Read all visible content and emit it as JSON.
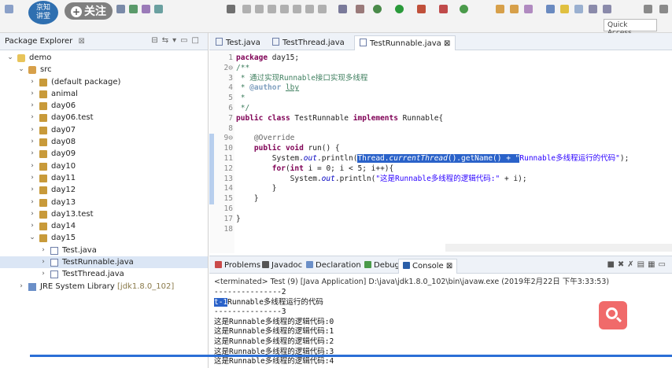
{
  "toolbar": {
    "watermark_line1": "京知",
    "watermark_line2": "讲堂",
    "follow_label": "关注",
    "quick_access": "Quick Access"
  },
  "package_explorer": {
    "title": "Package Explorer",
    "tree": [
      {
        "label": "demo",
        "depth": 0,
        "twist": "down",
        "icon": "project"
      },
      {
        "label": "src",
        "depth": 1,
        "twist": "down",
        "icon": "src"
      },
      {
        "label": "(default package)",
        "depth": 2,
        "twist": "right",
        "icon": "package"
      },
      {
        "label": "animal",
        "depth": 2,
        "twist": "right",
        "icon": "package"
      },
      {
        "label": "day06",
        "depth": 2,
        "twist": "right",
        "icon": "package"
      },
      {
        "label": "day06.test",
        "depth": 2,
        "twist": "right",
        "icon": "package"
      },
      {
        "label": "day07",
        "depth": 2,
        "twist": "right",
        "icon": "package"
      },
      {
        "label": "day08",
        "depth": 2,
        "twist": "right",
        "icon": "package"
      },
      {
        "label": "day09",
        "depth": 2,
        "twist": "right",
        "icon": "package"
      },
      {
        "label": "day10",
        "depth": 2,
        "twist": "right",
        "icon": "package"
      },
      {
        "label": "day11",
        "depth": 2,
        "twist": "right",
        "icon": "package"
      },
      {
        "label": "day12",
        "depth": 2,
        "twist": "right",
        "icon": "package"
      },
      {
        "label": "day13",
        "depth": 2,
        "twist": "right",
        "icon": "package"
      },
      {
        "label": "day13.test",
        "depth": 2,
        "twist": "right",
        "icon": "package"
      },
      {
        "label": "day14",
        "depth": 2,
        "twist": "right",
        "icon": "package"
      },
      {
        "label": "day15",
        "depth": 2,
        "twist": "down",
        "icon": "package"
      },
      {
        "label": "Test.java",
        "depth": 3,
        "twist": "right",
        "icon": "java"
      },
      {
        "label": "TestRunnable.java",
        "depth": 3,
        "twist": "right",
        "icon": "java",
        "selected": true
      },
      {
        "label": "TestThread.java",
        "depth": 3,
        "twist": "right",
        "icon": "java"
      },
      {
        "label": "JRE System Library",
        "sub": "[jdk1.8.0_102]",
        "depth": 1,
        "twist": "right",
        "icon": "library"
      }
    ]
  },
  "editor": {
    "tabs": [
      {
        "label": "Test.java",
        "active": false
      },
      {
        "label": "TestThread.java",
        "active": false
      },
      {
        "label": "TestRunnable.java",
        "active": true
      }
    ],
    "lines": [
      {
        "n": "1",
        "html": "<span class='kw'>package</span> day15;"
      },
      {
        "n": "2⊖",
        "html": "<span class='cm'>/**</span>"
      },
      {
        "n": "3",
        "html": "<span class='cm'> * 通过实现Runnable接口实现多线程</span>"
      },
      {
        "n": "4",
        "html": "<span class='cm'> * </span><span class='tag'>@author</span><span class='cm'> <u>lby</u></span>"
      },
      {
        "n": "5",
        "html": "<span class='cm'> *</span>"
      },
      {
        "n": "6",
        "html": "<span class='cm'> */</span>"
      },
      {
        "n": "7",
        "html": "<span class='kw'>public</span> <span class='kw'>class</span> TestRunnable <span class='kw'>implements</span> Runnable{"
      },
      {
        "n": "8",
        "html": ""
      },
      {
        "n": "9⊖",
        "html": "    <span class='ann'>@Override</span>"
      },
      {
        "n": "10",
        "html": "    <span class='kw'>public</span> <span class='kw'>void</span> run() {"
      },
      {
        "n": "11",
        "html": "        System.<span class='fld'>out</span>.println(<span class='hl'>Thread.<i>currentThread</i>().getName() + \"</span><span class='st'>Runnable多线程运行的代码\"</span>);"
      },
      {
        "n": "12",
        "html": "        <span class='kw'>for</span>(<span class='kw'>int</span> i = 0; i &lt; 5; i++){"
      },
      {
        "n": "13",
        "html": "            System.<span class='fld'>out</span>.println(<span class='st'>\"这是Runnable多线程的逻辑代码:\"</span> + i);"
      },
      {
        "n": "14",
        "html": "        }"
      },
      {
        "n": "15",
        "html": "    }"
      },
      {
        "n": "16",
        "html": ""
      },
      {
        "n": "17",
        "html": "}"
      },
      {
        "n": "18",
        "html": ""
      }
    ]
  },
  "console": {
    "tabs": [
      {
        "label": "Problems",
        "active": false,
        "color": "#c94a4a"
      },
      {
        "label": "Javadoc",
        "active": false,
        "color": "#555555"
      },
      {
        "label": "Declaration",
        "active": false,
        "color": "#6b8fc8"
      },
      {
        "label": "Debug",
        "active": false,
        "color": "#4a9a4a"
      },
      {
        "label": "Console",
        "active": true,
        "color": "#2b5fa8"
      }
    ],
    "terminated": "<terminated> Test (9) [Java Application] D:\\java\\jdk1.8.0_102\\bin\\javaw.exe (2019年2月22日 下午3:33:53)",
    "output_lines": [
      "---------------2",
      "t-1Runnable多线程运行的代码",
      "---------------3",
      "这是Runnable多线程的逻辑代码:0",
      "这是Runnable多线程的逻辑代码:1",
      "这是Runnable多线程的逻辑代码:2",
      "这是Runnable多线程的逻辑代码:3",
      "这是Runnable多线程的逻辑代码:4"
    ]
  },
  "colors": {
    "selection": "#2a62c9",
    "keyword": "#7f0055",
    "comment": "#3f7f5f",
    "string": "#2a00ff",
    "search_fab": "#f06a6a"
  }
}
